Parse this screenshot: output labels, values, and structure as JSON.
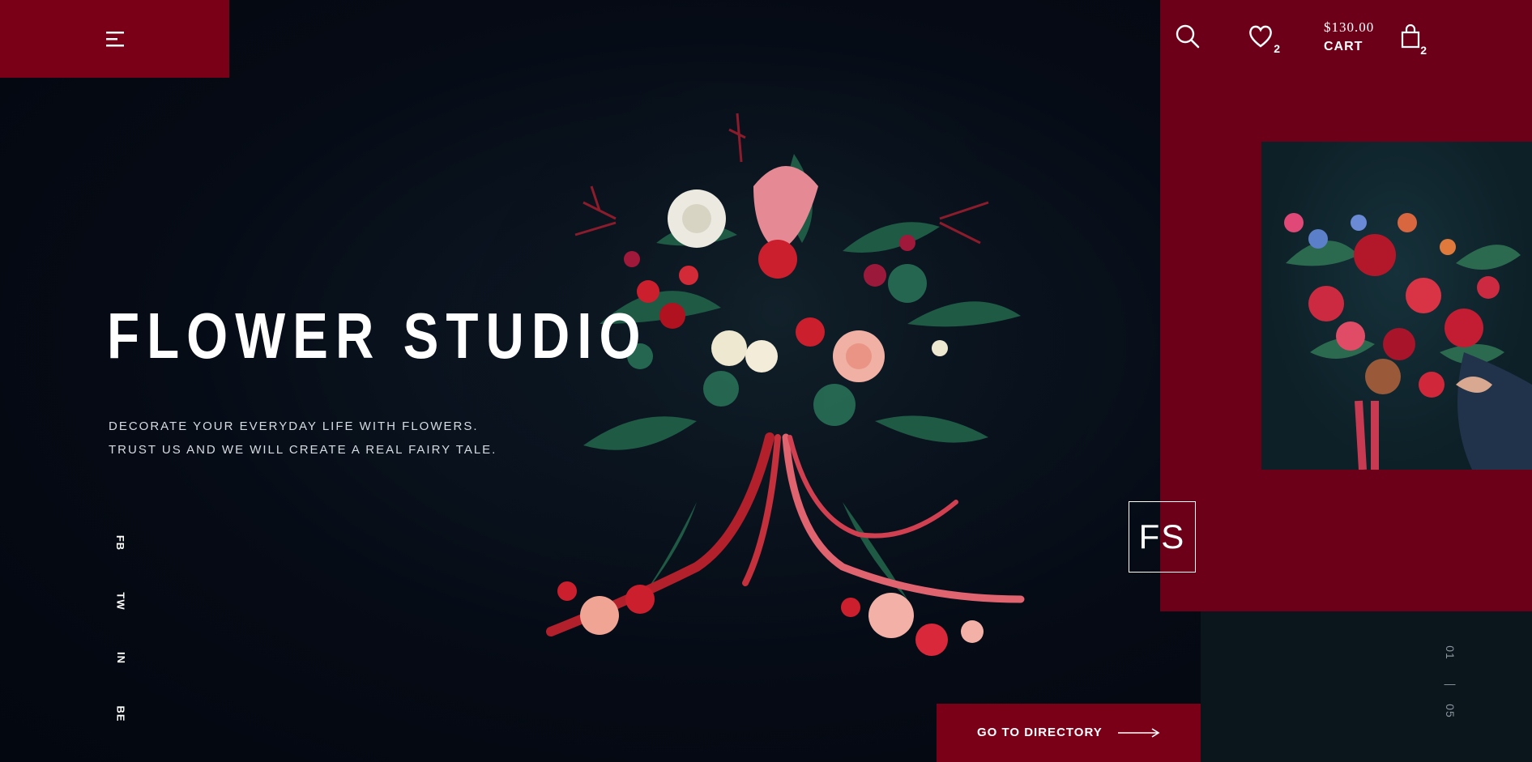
{
  "header": {
    "menu_icon": "hamburger-menu-icon",
    "search_icon": "search-icon",
    "wishlist": {
      "icon": "heart-icon",
      "count": "2"
    },
    "cart": {
      "price": "$130.00",
      "label": "CART",
      "icon": "shopping-bag-icon",
      "count": "2"
    }
  },
  "hero": {
    "title": "FLOWER STUDIO",
    "subtitle_line1": "DECORATE YOUR EVERYDAY LIFE WITH FLOWERS.",
    "subtitle_line2": "TRUST US AND WE WILL CREATE A REAL FAIRY TALE."
  },
  "social": [
    "FB",
    "TW",
    "IN",
    "BE"
  ],
  "logo": {
    "text": "FS"
  },
  "cta": {
    "label": "GO TO DIRECTORY",
    "icon": "arrow-right-icon"
  },
  "pager": {
    "current": "01",
    "separator": "—",
    "total": "05"
  },
  "colors": {
    "accent": "#7a0018",
    "panel": "#6d0019",
    "background": "#050a14"
  }
}
